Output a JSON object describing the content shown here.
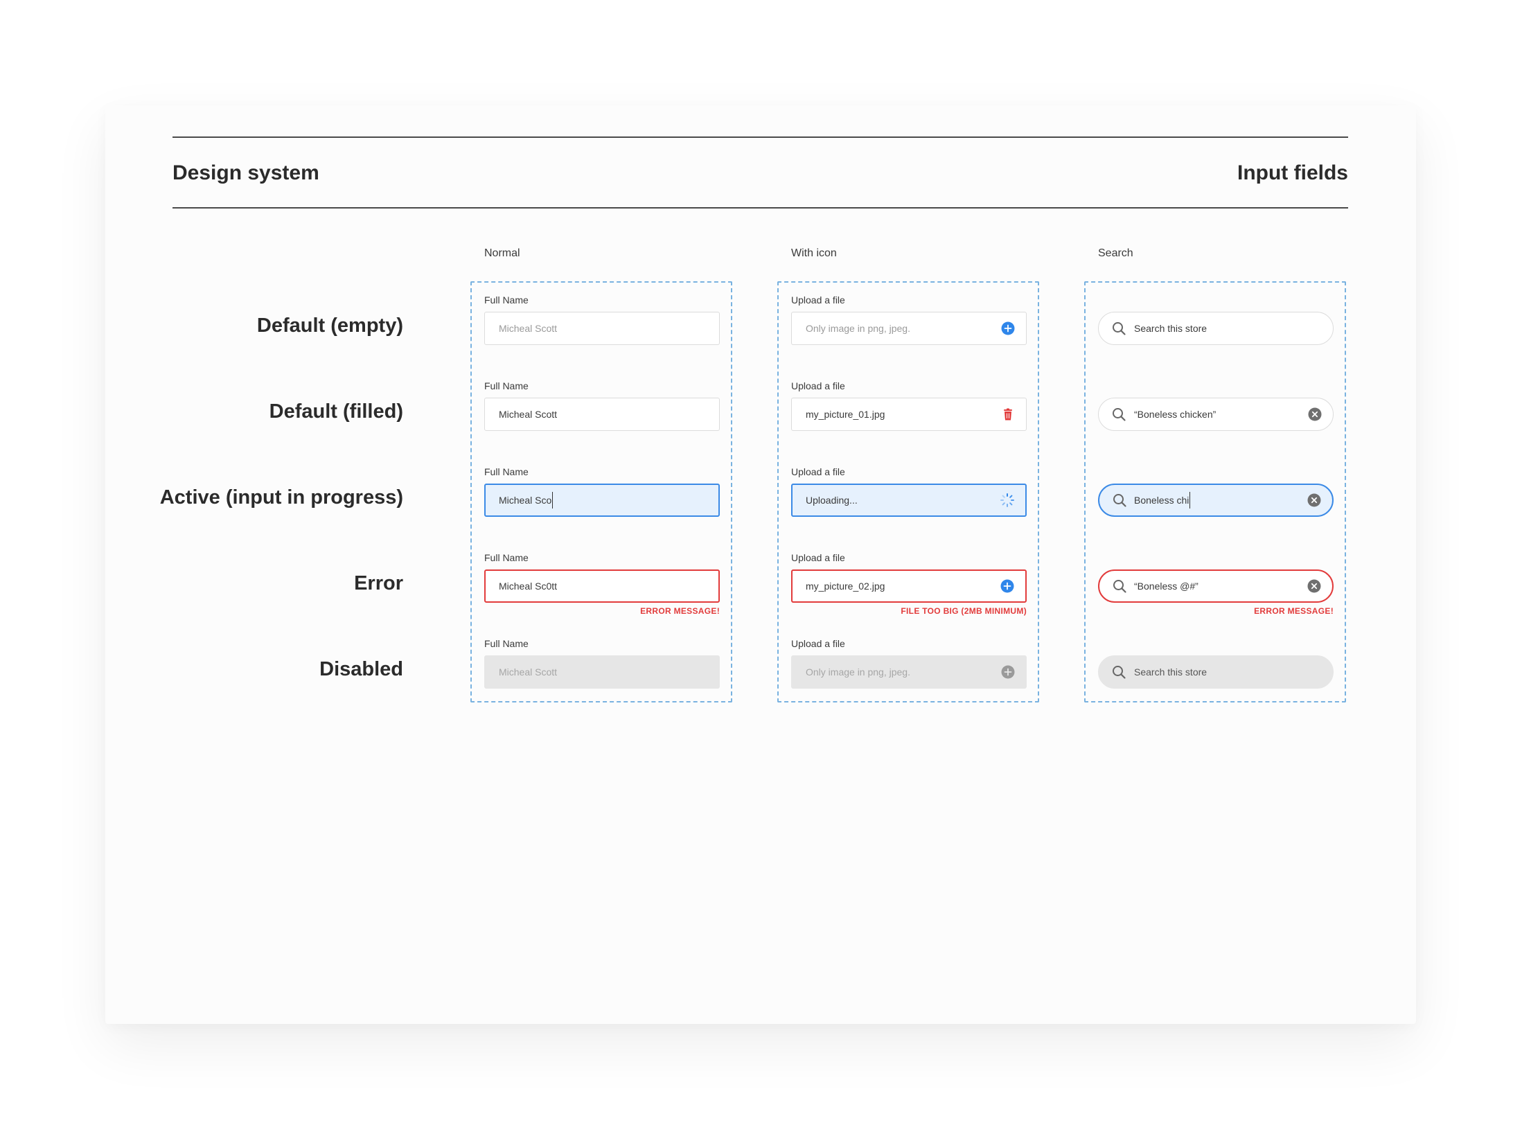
{
  "header": {
    "left_title": "Design system",
    "right_title": "Input fields"
  },
  "columns": {
    "normal": "Normal",
    "with_icon": "With icon",
    "search": "Search"
  },
  "rows": {
    "default_empty": "Default (empty)",
    "default_filled": "Default (filled)",
    "active": "Active (input in progress)",
    "error": "Error",
    "disabled": "Disabled"
  },
  "normal": {
    "label": "Full Name",
    "empty_placeholder": "Micheal Scott",
    "filled_value": "Micheal Scott",
    "active_value": "Micheal Sco",
    "error_value": "Micheal Sc0tt",
    "error_message": "ERROR MESSAGE!",
    "disabled_placeholder": "Micheal Scott"
  },
  "with_icon": {
    "label": "Upload a file",
    "empty_placeholder": "Only image in png, jpeg.",
    "filled_value": "my_picture_01.jpg",
    "active_value": "Uploading...",
    "error_value": "my_picture_02.jpg",
    "error_message": "FILE TOO BIG (2MB MINIMUM)",
    "disabled_placeholder": "Only image in png, jpeg.",
    "icons": {
      "empty": "plus-circle-icon",
      "filled": "trash-icon",
      "active": "spinner-icon",
      "error": "plus-circle-icon",
      "disabled": "plus-circle-icon"
    }
  },
  "search": {
    "empty_placeholder": "Search this store",
    "filled_value": "“Boneless chicken”",
    "active_value": "Boneless chi",
    "error_value": "“Boneless @#”",
    "error_message": "ERROR MESSAGE!",
    "disabled_placeholder": "Search this store",
    "icons": {
      "leading": "search-icon",
      "clear": "clear-circle-icon"
    }
  },
  "colors": {
    "accent": "#3b8ae6",
    "active_bg": "#e6f1fd",
    "error": "#e23b3b",
    "dashed_border": "#79b2e0",
    "disabled_bg": "#e6e6e6"
  }
}
